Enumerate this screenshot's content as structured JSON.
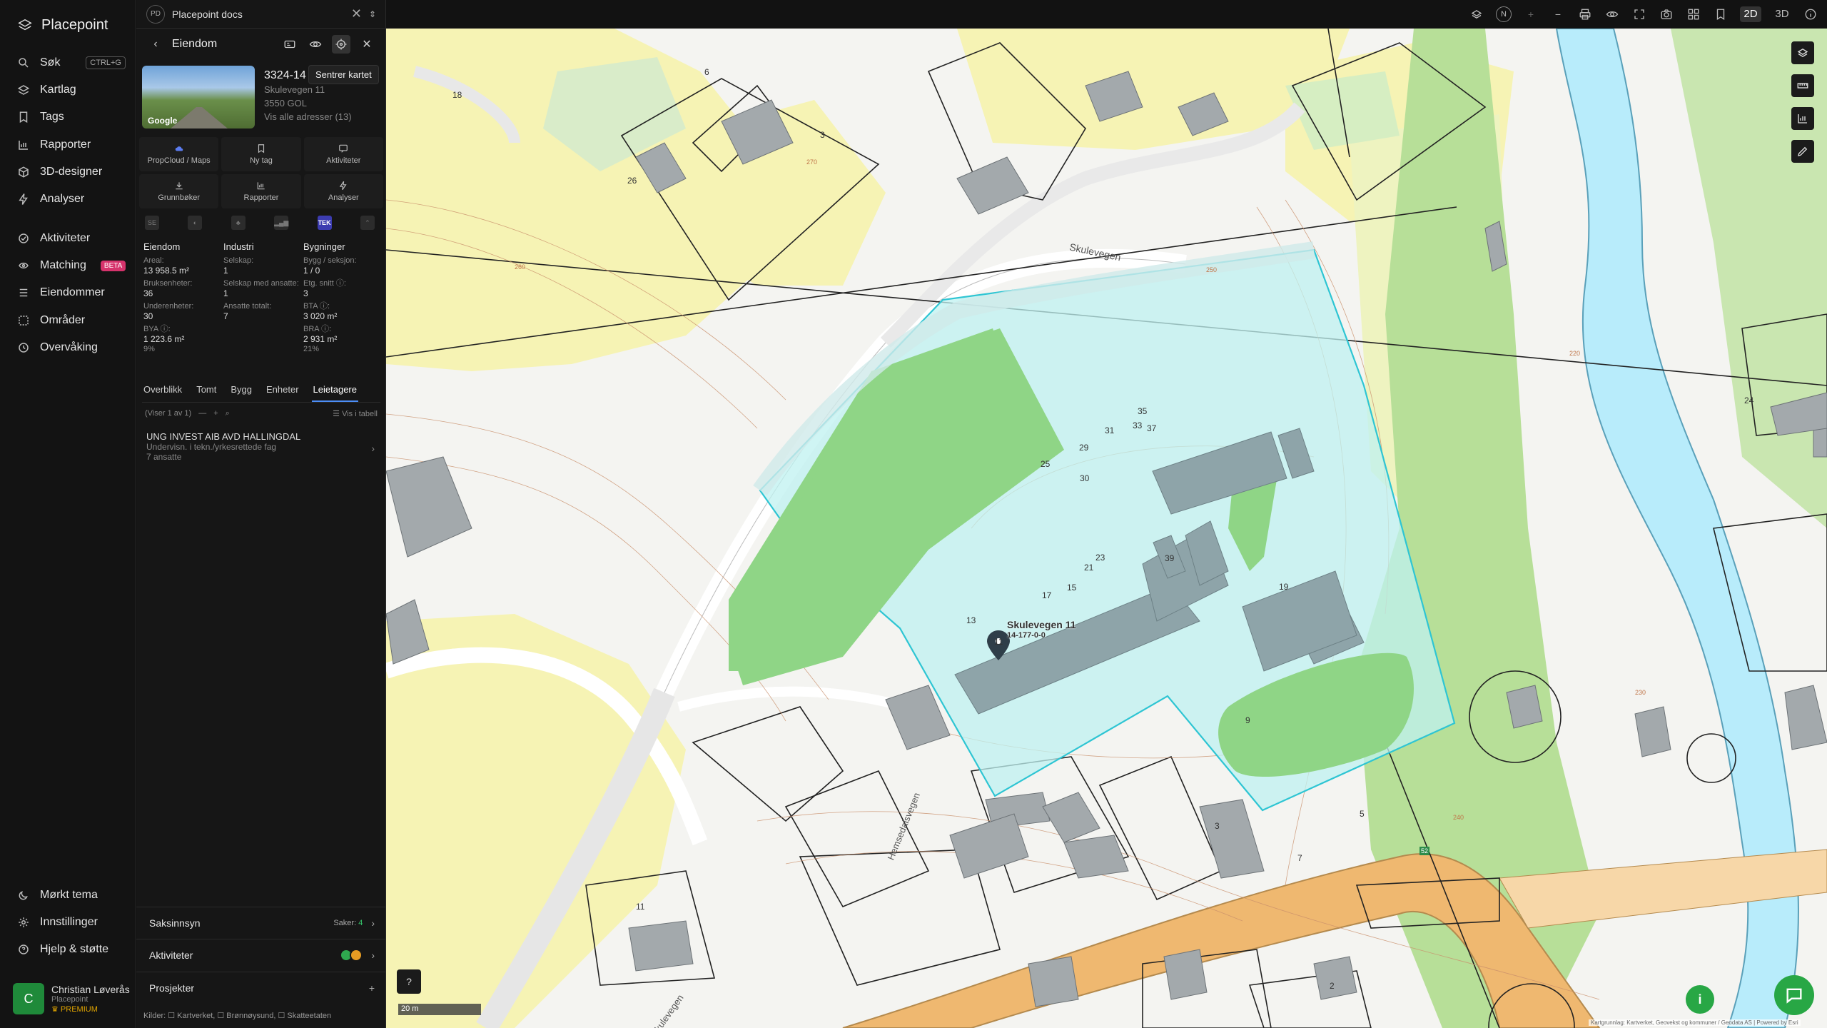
{
  "app": {
    "name": "Placepoint"
  },
  "nav": {
    "items": [
      {
        "label": "Søk",
        "shortcut": "CTRL+G",
        "icon": "search-icon"
      },
      {
        "label": "Kartlag",
        "icon": "layers-icon"
      },
      {
        "label": "Tags",
        "icon": "bookmark-icon"
      },
      {
        "label": "Rapporter",
        "icon": "chart-icon"
      },
      {
        "label": "3D-designer",
        "icon": "cube-icon"
      },
      {
        "label": "Analyser",
        "icon": "bolt-icon"
      }
    ],
    "items2": [
      {
        "label": "Aktiviteter",
        "icon": "activity-icon"
      },
      {
        "label": "Matching",
        "badge": "BETA",
        "icon": "matching-icon"
      },
      {
        "label": "Eiendommer",
        "icon": "list-icon"
      },
      {
        "label": "Områder",
        "icon": "area-icon"
      },
      {
        "label": "Overvåking",
        "icon": "monitor-icon"
      }
    ],
    "bottom": [
      {
        "label": "Mørkt tema",
        "icon": "moon-icon"
      },
      {
        "label": "Innstillinger",
        "icon": "gear-icon"
      },
      {
        "label": "Hjelp & støtte",
        "icon": "help-icon"
      }
    ],
    "user": {
      "initial": "C",
      "name": "Christian Løverås",
      "org": "Placepoint",
      "plan": "PREMIUM"
    }
  },
  "docs_bar": {
    "badge": "PD",
    "title": "Placepoint docs"
  },
  "property": {
    "header": "Eiendom",
    "tooltip": "Sentrer kartet",
    "gnr": "3324-14",
    "street": "Skulevegen 11",
    "postal": "3550 GOL",
    "all_addresses": "Vis alle adresser (13)",
    "photo_credit": "Google",
    "actions": [
      "PropCloud / Maps",
      "Ny tag",
      "Aktiviteter",
      "Grunnbøker",
      "Rapporter",
      "Analyser"
    ],
    "source_tek": "TEK",
    "stats": {
      "eiendom": {
        "title": "Eiendom",
        "areal_label": "Areal:",
        "areal": "13 958.5 m²",
        "bruksenheter_label": "Bruksenheter:",
        "bruksenheter": "36",
        "underenheter_label": "Underenheter:",
        "underenheter": "30",
        "bya_label": "BYA ⓘ:",
        "bya": "1 223.6 m²",
        "bya_pct": "9%"
      },
      "industri": {
        "title": "Industri",
        "selskap_label": "Selskap:",
        "selskap": "1",
        "ansatte_label": "Selskap med ansatte:",
        "ansatte": "1",
        "total_label": "Ansatte totalt:",
        "total": "7"
      },
      "bygninger": {
        "title": "Bygninger",
        "bygg_label": "Bygg / seksjon:",
        "bygg": "1 / 0",
        "etg_label": "Etg. snitt ⓘ:",
        "etg": "3",
        "bta_label": "BTA ⓘ:",
        "bta": "3 020 m²",
        "bra_label": "BRA ⓘ:",
        "bra": "2 931 m²",
        "bra_pct": "21%"
      }
    },
    "tabs": [
      "Overblikk",
      "Tomt",
      "Bygg",
      "Enheter",
      "Leietagere"
    ],
    "active_tab": "Leietagere",
    "list_count": "(Viser 1 av 1)",
    "list_table": "Vis i tabell",
    "tenant": {
      "name": "UNG INVEST AIB AVD HALLINGDAL",
      "desc": "Undervisn. i tekn./yrkesrettede fag",
      "employees": "7 ansatte"
    },
    "sections": {
      "saksinnsyn": "Saksinnsyn",
      "saker_label": "Saker:",
      "saker": "4",
      "aktiviteter": "Aktiviteter",
      "prosjekter": "Prosjekter"
    },
    "sources": "Kilder: ☐ Kartverket, ☐ Brønnøysund, ☐ Skatteetaten"
  },
  "map": {
    "north": "N",
    "mode_2d": "2D",
    "mode_3d": "3D",
    "scale": "20 m",
    "pin_address": "Skulevegen 11",
    "pin_id": "14-177-0-0",
    "road_label_1": "Skulevegen",
    "road_label_2": "Hemsedalsvegen",
    "road_label_3": "Skulevegen",
    "attribution": "Kartgrunnlag: Kartverket, Geovekst og kommuner / Geodata AS | Powered by Esri",
    "route_number": "52",
    "house_numbers": [
      "18",
      "6",
      "26",
      "3",
      "24",
      "35",
      "33",
      "37",
      "31",
      "29",
      "25",
      "30",
      "23",
      "21",
      "19",
      "17",
      "15",
      "13",
      "11",
      "39",
      "9",
      "5",
      "3",
      "7",
      "11",
      "2"
    ],
    "contour_labels": [
      "270",
      "260",
      "250",
      "240",
      "230",
      "220"
    ],
    "colors": {
      "parcel": "#2ec5d3",
      "green": "#8fd586",
      "yellow": "#f6f3b4",
      "building": "#8ea4a9",
      "water": "#b8ecfb",
      "road": "#efb870"
    }
  }
}
